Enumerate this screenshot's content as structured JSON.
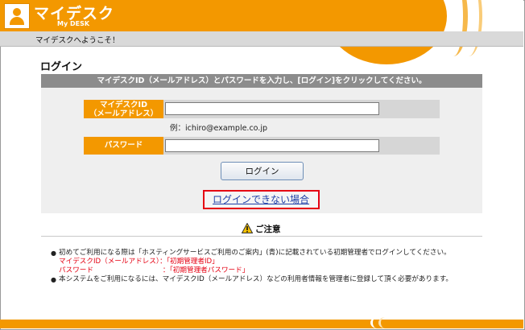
{
  "header": {
    "title": "マイデスク",
    "subtitle": "My DESK"
  },
  "welcome": {
    "text": "マイデスクへようこそ！"
  },
  "login": {
    "title": "ログイン",
    "instruction": "マイデスクID（メールアドレス）とパスワードを入力し、[ログイン]をクリックしてください。",
    "id_label_1": "マイデスクID",
    "id_label_2": "（メールアドレス）",
    "id_value": "",
    "example": "例：ichiro@example.co.jp",
    "password_label": "パスワード",
    "password_value": "",
    "button_label": "ログイン",
    "help_link": "ログインできない場合"
  },
  "caution": {
    "title": "ご注意",
    "note1": "初めてご利用になる際は「ホスティングサービスご利用のご案内」(青)に記載されている初期管理者でログインしてください。",
    "note1_id": "マイデスクID（メールアドレス）：「初期管理者ID」",
    "note1_pw": "パスワード　　　　　　　　　　：「初期管理者パスワード」",
    "note2": "本システムをご利用になるには、マイデスクID（メールアドレス）などの利用者情報を管理者に登録して頂く必要があります。"
  },
  "colors": {
    "brand": "#f39800",
    "instruction_bar": "#8c8c8c",
    "highlight": "#e50012",
    "link": "#1f3fa8"
  }
}
